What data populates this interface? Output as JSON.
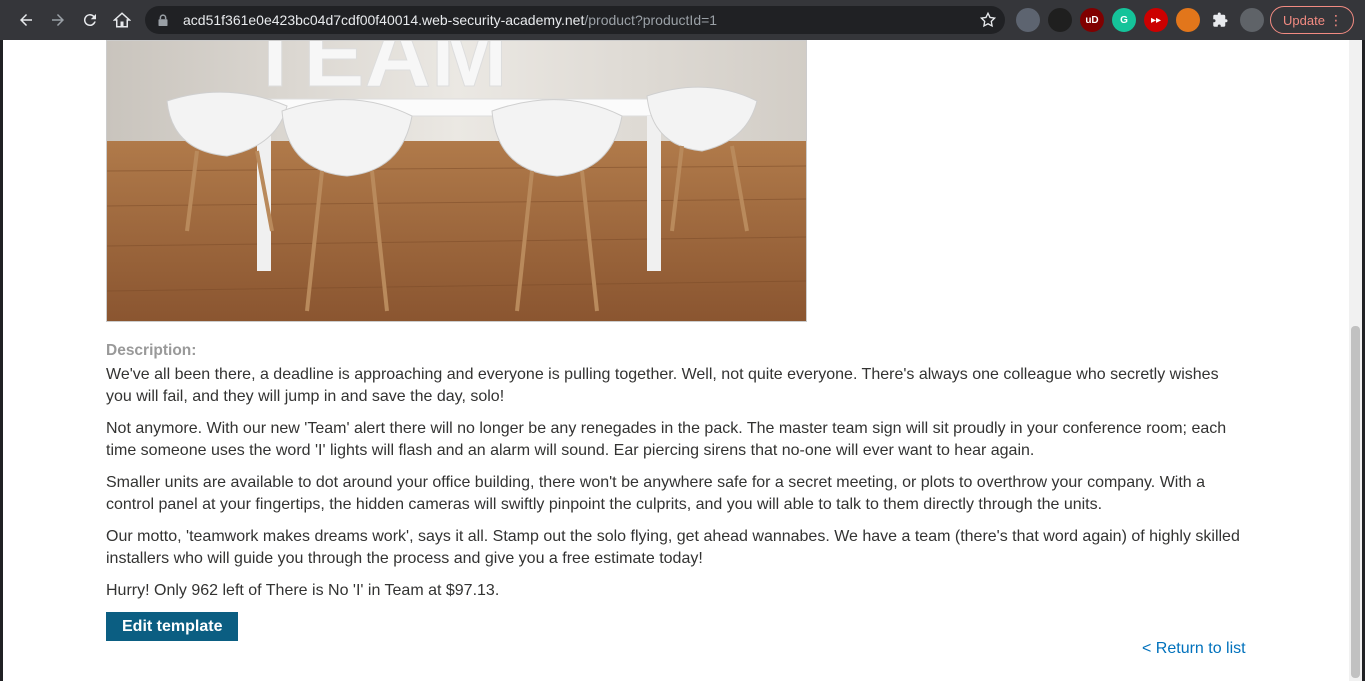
{
  "browser": {
    "url_host": "acd51f361e0e423bc04d7cdf00f40014.web-security-academy.net",
    "url_path": "/product?productId=1",
    "update_label": "Update",
    "extensions": [
      {
        "name": "ghostery-icon",
        "color": "#5d6470",
        "glyph": ""
      },
      {
        "name": "ninja-icon",
        "color": "#1f1f1f",
        "glyph": ""
      },
      {
        "name": "ublock-icon",
        "color": "#800000",
        "glyph": "uD"
      },
      {
        "name": "grammarly-icon",
        "color": "#15c39a",
        "glyph": "G"
      },
      {
        "name": "youtube-ext-icon",
        "color": "#cc0000",
        "glyph": "▸▸"
      },
      {
        "name": "metamask-icon",
        "color": "#e2761b",
        "glyph": ""
      },
      {
        "name": "extensions-puzzle-icon",
        "color": "transparent",
        "glyph": ""
      },
      {
        "name": "profile-avatar",
        "color": "#5f6368",
        "glyph": ""
      }
    ]
  },
  "product": {
    "image_text": "TEAM",
    "description_label": "Description:",
    "paragraphs": [
      "We've all been there, a deadline is approaching and everyone is pulling together. Well, not quite everyone. There's always one colleague who secretly wishes you will fail, and they will jump in and save the day, solo!",
      "Not anymore. With our new 'Team' alert there will no longer be any renegades in the pack. The master team sign will sit proudly in your conference room; each time someone uses the word 'I' lights will flash and an alarm will sound. Ear piercing sirens that no-one will ever want to hear again.",
      "Smaller units are available to dot around your office building, there won't be anywhere safe for a secret meeting, or plots to overthrow your company. With a control panel at your fingertips, the hidden cameras will swiftly pinpoint the culprits, and you will able to talk to them directly through the units.",
      "Our motto, 'teamwork makes dreams work', says it all. Stamp out the solo flying, get ahead wannabes. We have a team (there's that word again) of highly skilled installers who will guide you through the process and give you a free estimate today!"
    ],
    "stock_text": "Hurry! Only 962 left of There is No 'I' in Team at $97.13.",
    "edit_button": "Edit template",
    "return_link": "< Return to list"
  }
}
